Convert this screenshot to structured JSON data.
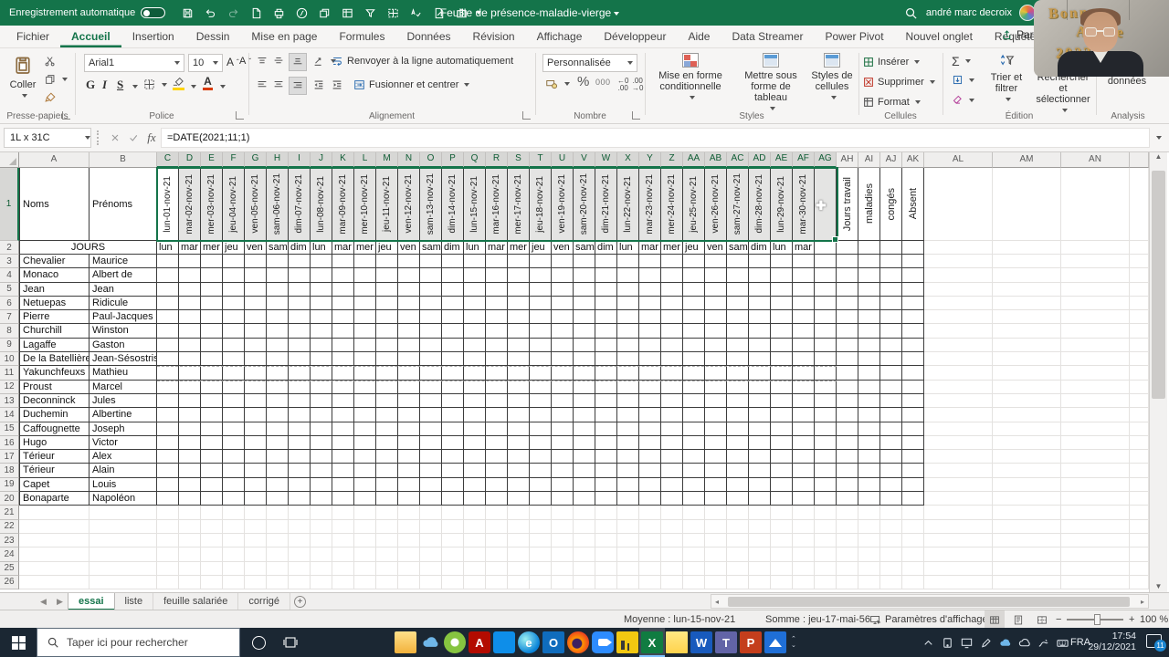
{
  "titlebar": {
    "autosave_label": "Enregistrement automatique",
    "doc_title": "Feuille de présence-maladie-vierge",
    "user_name": "andré marc decroix",
    "qat_icons": [
      "save",
      "undo",
      "redo",
      "new-file",
      "print-preview",
      "insert-function",
      "switch-windows",
      "insert-table",
      "filter",
      "borders",
      "spellcheck",
      "document-edit",
      "screenshot"
    ]
  },
  "ribbon_tabs": [
    {
      "label": "Fichier",
      "active": false
    },
    {
      "label": "Accueil",
      "active": true
    },
    {
      "label": "Insertion",
      "active": false
    },
    {
      "label": "Dessin",
      "active": false
    },
    {
      "label": "Mise en page",
      "active": false
    },
    {
      "label": "Formules",
      "active": false
    },
    {
      "label": "Données",
      "active": false
    },
    {
      "label": "Révision",
      "active": false
    },
    {
      "label": "Affichage",
      "active": false
    },
    {
      "label": "Développeur",
      "active": false
    },
    {
      "label": "Aide",
      "active": false
    },
    {
      "label": "Data Streamer",
      "active": false
    },
    {
      "label": "Power Pivot",
      "active": false
    },
    {
      "label": "Nouvel onglet",
      "active": false
    },
    {
      "label": "Requête",
      "active": false
    }
  ],
  "share_label": "Partager",
  "ribbon": {
    "clipboard": {
      "label": "Presse-papiers",
      "paste": "Coller"
    },
    "font": {
      "label": "Police",
      "name": "Arial1",
      "size": "10",
      "bold": "G",
      "italic": "I",
      "underline": "S"
    },
    "alignment": {
      "label": "Alignement",
      "wrap": "Renvoyer à la ligne automatiquement",
      "merge": "Fusionner et centrer"
    },
    "number": {
      "label": "Nombre",
      "format": "Personnalisée",
      "percent": "%",
      "thousands": "000"
    },
    "styles": {
      "label": "Styles",
      "conditional": "Mise en forme conditionnelle",
      "table": "Mettre sous forme de tableau",
      "cells": "Styles de cellules"
    },
    "cells": {
      "label": "Cellules",
      "insert": "Insérer",
      "delete": "Supprimer",
      "format": "Format"
    },
    "editing": {
      "label": "Édition",
      "sort": "Trier et filtrer",
      "find": "Rechercher et sélectionner"
    },
    "analysis": {
      "label": "Analysis",
      "button": "Analyse de données"
    }
  },
  "formula_bar": {
    "name_box": "1L x 31C",
    "formula": "=DATE(2021;11;1)"
  },
  "grid": {
    "columns": [
      "A",
      "B",
      "C",
      "D",
      "E",
      "F",
      "G",
      "H",
      "I",
      "J",
      "K",
      "L",
      "M",
      "N",
      "O",
      "P",
      "Q",
      "R",
      "S",
      "T",
      "U",
      "V",
      "W",
      "X",
      "Y",
      "Z",
      "AA",
      "AB",
      "AC",
      "AD",
      "AE",
      "AF",
      "AG",
      "AH",
      "AI",
      "AJ",
      "AK",
      "AL",
      "AM",
      "AN"
    ],
    "corner_a": "Noms",
    "corner_b": "Prénoms",
    "jours": "JOURS",
    "dates": [
      "lun-01-nov-21",
      "mar-02-nov-21",
      "mer-03-nov-21",
      "jeu-04-nov-21",
      "ven-05-nov-21",
      "sam-06-nov-21",
      "dim-07-nov-21",
      "lun-08-nov-21",
      "mar-09-nov-21",
      "mer-10-nov-21",
      "jeu-11-nov-21",
      "ven-12-nov-21",
      "sam-13-nov-21",
      "dim-14-nov-21",
      "lun-15-nov-21",
      "mar-16-nov-21",
      "mer-17-nov-21",
      "jeu-18-nov-21",
      "ven-19-nov-21",
      "sam-20-nov-21",
      "dim-21-nov-21",
      "lun-22-nov-21",
      "mar-23-nov-21",
      "mer-24-nov-21",
      "jeu-25-nov-21",
      "ven-26-nov-21",
      "sam-27-nov-21",
      "dim-28-nov-21",
      "lun-29-nov-21",
      "mar-30-nov-21"
    ],
    "summary_headers": [
      "Jours travail",
      "maladies",
      "congés",
      "Absent"
    ],
    "people": [
      [
        "Chevalier",
        "Maurice"
      ],
      [
        "Monaco",
        "Albert de"
      ],
      [
        "Jean",
        "Jean"
      ],
      [
        "Netuepas",
        "Ridicule"
      ],
      [
        "Pierre",
        "Paul-Jacques"
      ],
      [
        "Churchill",
        "Winston"
      ],
      [
        "Lagaffe",
        "Gaston"
      ],
      [
        "De la Batellière",
        "Jean-Sésostris"
      ],
      [
        "Yakunchfeuxs",
        "Mathieu"
      ],
      [
        "Proust",
        "Marcel"
      ],
      [
        "Deconninck",
        "Jules"
      ],
      [
        "Duchemin",
        "Albertine"
      ],
      [
        "Caffougnette",
        "Joseph"
      ],
      [
        "Hugo",
        "Victor"
      ],
      [
        "Térieur",
        "Alex"
      ],
      [
        "Térieur",
        "Alain"
      ],
      [
        "Capet",
        "Louis"
      ],
      [
        "Bonaparte",
        "Napoléon"
      ]
    ]
  },
  "sheet_tabs": [
    {
      "label": "essai",
      "active": true
    },
    {
      "label": "liste",
      "active": false
    },
    {
      "label": "feuille salariée",
      "active": false
    },
    {
      "label": "corrigé",
      "active": false
    }
  ],
  "status_bar": {
    "average": "Moyenne : lun-15-nov-21",
    "sum": "Somme : jeu-17-mai-56",
    "display_settings": "Paramètres d'affichage",
    "zoom": "100 %"
  },
  "taskbar": {
    "search_placeholder": "Taper ici pour rechercher",
    "apps": [
      "file-explorer",
      "onedrive",
      "camtasia",
      "acrobat",
      "teamviewer",
      "edge",
      "outlook",
      "firefox",
      "zoom",
      "power-bi",
      "excel",
      "sticky-notes",
      "word",
      "teams",
      "powerpoint",
      "photos"
    ],
    "active_app": "excel",
    "tray_icons": [
      "chevron-up",
      "tablet",
      "display",
      "pen",
      "onedrive-cloud",
      "cloud",
      "ink-pen",
      "keyboard"
    ],
    "language": "FRA",
    "time": "17:54",
    "date": "29/12/2021",
    "notification_count": "11"
  },
  "webcam": {
    "line1": "Bonne",
    "line2": "Année",
    "line3": "2022"
  }
}
